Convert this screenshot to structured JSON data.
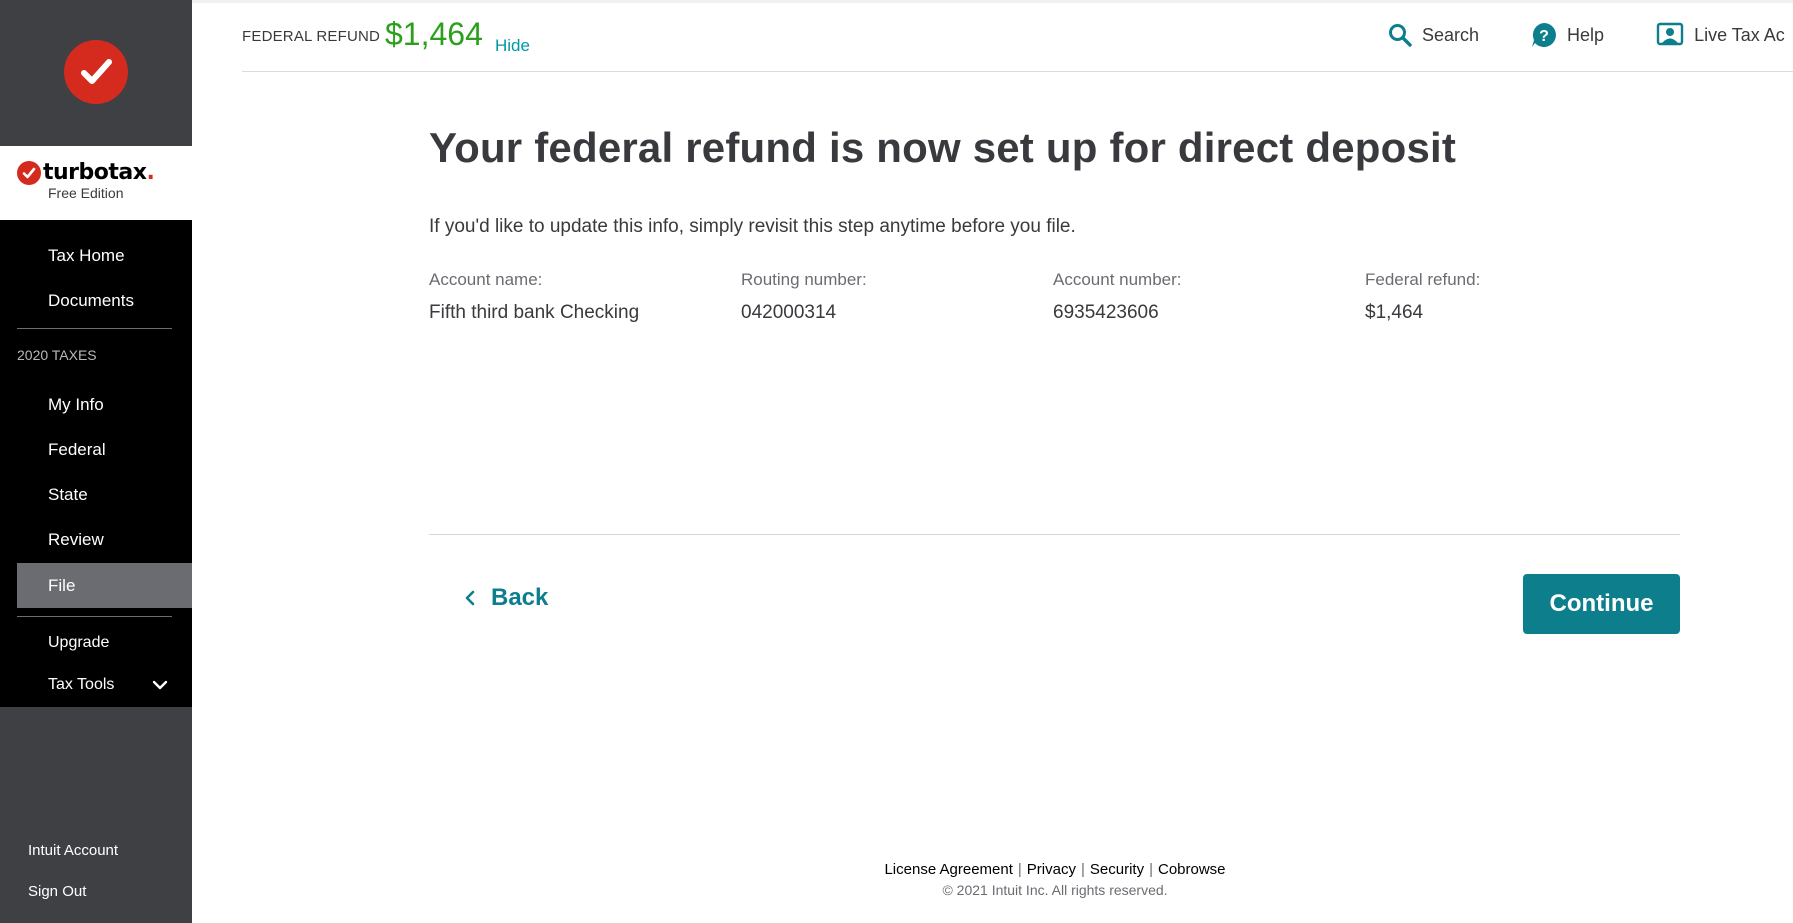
{
  "header": {
    "refund_label": "FEDERAL REFUND",
    "refund_amount": "$1,464",
    "hide_label": "Hide",
    "actions": {
      "search": "Search",
      "help": "Help",
      "live": "Live Tax Ac"
    }
  },
  "sidebar": {
    "brand": {
      "name": "turbotax",
      "dot": ".",
      "edition": "Free Edition"
    },
    "nav_top": [
      "Tax Home",
      "Documents"
    ],
    "section_label": "2020 TAXES",
    "nav_taxes": [
      "My Info",
      "Federal",
      "State",
      "Review",
      "File"
    ],
    "nav_bottom": [
      "Upgrade",
      "Tax Tools"
    ],
    "account": [
      "Intuit Account",
      "Sign Out"
    ]
  },
  "main": {
    "title": "Your federal refund is now set up for direct deposit",
    "subtitle": "If you'd like to update this info, simply revisit this step anytime before you file.",
    "fields": [
      {
        "label": "Account name:",
        "value": "Fifth third bank Checking"
      },
      {
        "label": "Routing number:",
        "value": "042000314"
      },
      {
        "label": "Account number:",
        "value": "6935423606"
      },
      {
        "label": "Federal refund:",
        "value": "$1,464"
      }
    ],
    "back_label": "Back",
    "continue_label": "Continue"
  },
  "footer": {
    "links": [
      "License Agreement",
      "Privacy",
      "Security",
      "Cobrowse"
    ],
    "copyright": "© 2021 Intuit Inc. All rights reserved."
  },
  "colors": {
    "brand_red": "#d52b1e",
    "accent_teal": "#0d7f8c",
    "refund_green": "#2ca01c",
    "sidebar_dark": "#3f4043"
  }
}
